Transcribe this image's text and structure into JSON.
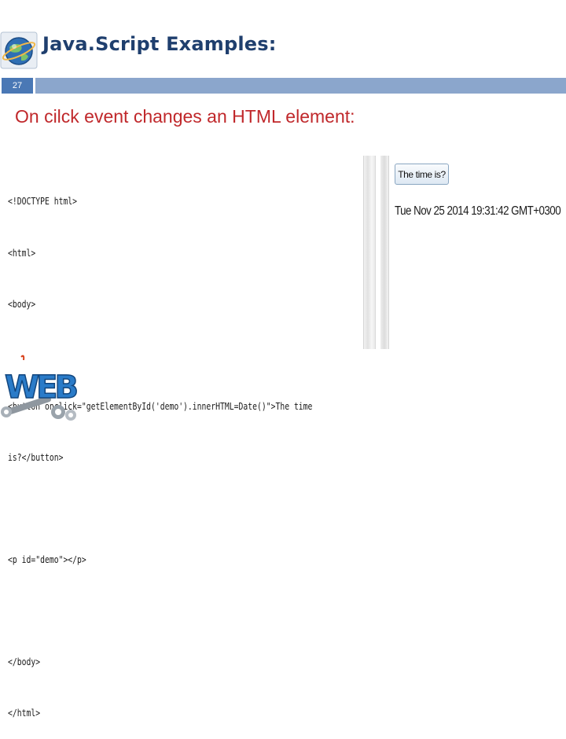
{
  "slide": {
    "title": "Java.Script Examples:",
    "number": "27",
    "subtitle": "On cilck event changes an HTML element:"
  },
  "code": {
    "lines": [
      "<!DOCTYPE html>",
      "<html>",
      "<body>",
      "",
      "<button onclick=\"getElementById('demo').innerHTML=Date()\">The time",
      "is?</button>",
      "",
      "<p id=\"demo\"></p>",
      "",
      "</body>",
      "</html>"
    ]
  },
  "preview": {
    "button_label": "The time is?",
    "output_text": "Tue Nov 25 2014 19:31:42 GMT+0300"
  },
  "logo": {
    "web_letters": "WEB",
    "icon": "globe-icon"
  },
  "colors": {
    "title": "#1f3f6e",
    "subtitle": "#c0282b",
    "accent_bar": "#8ba6cc",
    "slide_number_bg": "#4a78b5"
  }
}
